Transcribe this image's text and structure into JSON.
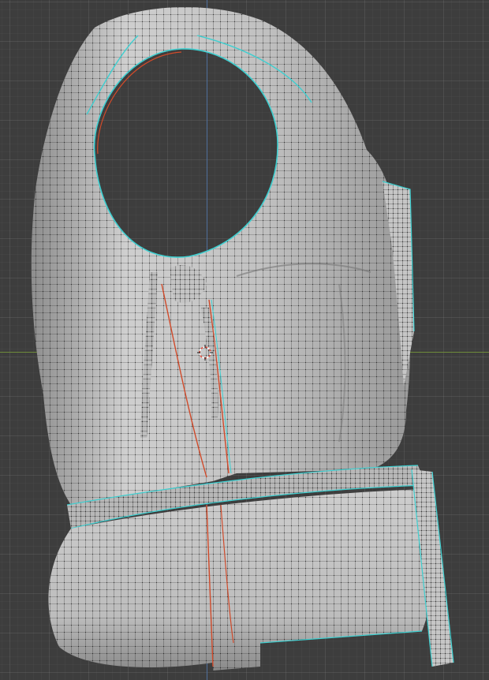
{
  "viewport": {
    "mode": "edit-mesh",
    "object": "life-vest",
    "background_color": "#3d3d3d",
    "grid_color": "#474747"
  },
  "axes": {
    "x_color": "#6e8a3a",
    "y_color": "#4f6f9c"
  },
  "mesh": {
    "surface_color": "#c8c8c8",
    "shadow_color": "#7c7c7c",
    "wire_color": "#0a0a0a",
    "seam_color": "#d04a2a",
    "boundary_color": "#3ecfd0"
  },
  "cursor": {
    "icon": "3d-cursor-icon",
    "ring_color_a": "#e04a3a",
    "ring_color_b": "#ffffff"
  }
}
